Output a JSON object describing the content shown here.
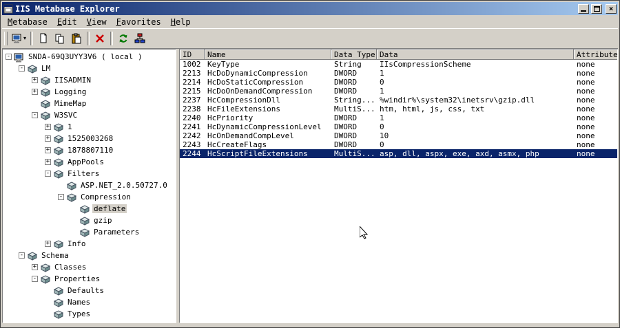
{
  "window": {
    "title": "IIS Metabase Explorer"
  },
  "colors": {
    "titlebar_start": "#0a246a",
    "titlebar_end": "#a6caf0",
    "selection": "#0a246a",
    "chrome": "#d4d0c8"
  },
  "menu": {
    "items": [
      {
        "label": "Metabase",
        "underline": 0
      },
      {
        "label": "Edit",
        "underline": 0
      },
      {
        "label": "View",
        "underline": 0
      },
      {
        "label": "Favorites",
        "underline": 0
      },
      {
        "label": "Help",
        "underline": 0
      }
    ]
  },
  "toolbar": {
    "buttons": [
      {
        "type": "button",
        "name": "connect",
        "icon": "computer",
        "dropdown": true
      },
      {
        "type": "separator"
      },
      {
        "type": "button",
        "name": "new-key",
        "icon": "page"
      },
      {
        "type": "button",
        "name": "copy",
        "icon": "copy"
      },
      {
        "type": "button",
        "name": "paste",
        "icon": "paste"
      },
      {
        "type": "separator"
      },
      {
        "type": "button",
        "name": "delete",
        "icon": "delete"
      },
      {
        "type": "separator"
      },
      {
        "type": "button",
        "name": "refresh",
        "icon": "refresh"
      },
      {
        "type": "button",
        "name": "network",
        "icon": "network"
      }
    ]
  },
  "tree": {
    "items": [
      {
        "label": "SNDA-69Q3UYY3V6 ( local )",
        "depth": 0,
        "expander": "minus",
        "icon": "computer",
        "selected": false
      },
      {
        "label": "LM",
        "depth": 1,
        "expander": "minus",
        "icon": "node",
        "selected": false
      },
      {
        "label": "IISADMIN",
        "depth": 2,
        "expander": "plus",
        "icon": "node",
        "selected": false
      },
      {
        "label": "Logging",
        "depth": 2,
        "expander": "plus",
        "icon": "node",
        "selected": false
      },
      {
        "label": "MimeMap",
        "depth": 2,
        "expander": "none",
        "icon": "node",
        "selected": false
      },
      {
        "label": "W3SVC",
        "depth": 2,
        "expander": "minus",
        "icon": "node",
        "selected": false
      },
      {
        "label": "1",
        "depth": 3,
        "expander": "plus",
        "icon": "node",
        "selected": false
      },
      {
        "label": "1525003268",
        "depth": 3,
        "expander": "plus",
        "icon": "node",
        "selected": false
      },
      {
        "label": "1878807110",
        "depth": 3,
        "expander": "plus",
        "icon": "node",
        "selected": false
      },
      {
        "label": "AppPools",
        "depth": 3,
        "expander": "plus",
        "icon": "node",
        "selected": false
      },
      {
        "label": "Filters",
        "depth": 3,
        "expander": "minus",
        "icon": "node",
        "selected": false
      },
      {
        "label": "ASP.NET_2.0.50727.0",
        "depth": 4,
        "expander": "none",
        "icon": "node",
        "selected": false
      },
      {
        "label": "Compression",
        "depth": 4,
        "expander": "minus",
        "icon": "node",
        "selected": false
      },
      {
        "label": "deflate",
        "depth": 5,
        "expander": "none",
        "icon": "node",
        "selected": true
      },
      {
        "label": "gzip",
        "depth": 5,
        "expander": "none",
        "icon": "node",
        "selected": false
      },
      {
        "label": "Parameters",
        "depth": 5,
        "expander": "none",
        "icon": "node",
        "selected": false
      },
      {
        "label": "Info",
        "depth": 3,
        "expander": "plus",
        "icon": "node",
        "selected": false
      },
      {
        "label": "Schema",
        "depth": 1,
        "expander": "minus",
        "icon": "node",
        "selected": false
      },
      {
        "label": "Classes",
        "depth": 2,
        "expander": "plus",
        "icon": "node",
        "selected": false
      },
      {
        "label": "Properties",
        "depth": 2,
        "expander": "minus",
        "icon": "node",
        "selected": false
      },
      {
        "label": "Defaults",
        "depth": 3,
        "expander": "none",
        "icon": "node",
        "selected": false
      },
      {
        "label": "Names",
        "depth": 3,
        "expander": "none",
        "icon": "node",
        "selected": false
      },
      {
        "label": "Types",
        "depth": 3,
        "expander": "none",
        "icon": "node",
        "selected": false
      }
    ]
  },
  "table": {
    "columns": [
      "ID",
      "Name",
      "Data Type",
      "Data",
      "Attributes"
    ],
    "selected_row_index": 10,
    "rows": [
      [
        "1002",
        "KeyType",
        "String",
        "IIsCompressionScheme",
        "none"
      ],
      [
        "2213",
        "HcDoDynamicCompression",
        "DWORD",
        "1",
        "none"
      ],
      [
        "2214",
        "HcDoStaticCompression",
        "DWORD",
        "0",
        "none"
      ],
      [
        "2215",
        "HcDoOnDemandCompression",
        "DWORD",
        "1",
        "none"
      ],
      [
        "2237",
        "HcCompressionDll",
        "String...",
        "%windir%\\system32\\inetsrv\\gzip.dll",
        "none"
      ],
      [
        "2238",
        "HcFileExtensions",
        "MultiS...",
        "htm, html, js, css, txt",
        "none"
      ],
      [
        "2240",
        "HcPriority",
        "DWORD",
        "1",
        "none"
      ],
      [
        "2241",
        "HcDynamicCompressionLevel",
        "DWORD",
        "0",
        "none"
      ],
      [
        "2242",
        "HcOnDemandCompLevel",
        "DWORD",
        "10",
        "none"
      ],
      [
        "2243",
        "HcCreateFlags",
        "DWORD",
        "0",
        "none"
      ],
      [
        "2244",
        "HcScriptFileExtensions",
        "MultiS...",
        "asp, dll, aspx, exe, axd, asmx, php",
        "none"
      ]
    ]
  }
}
